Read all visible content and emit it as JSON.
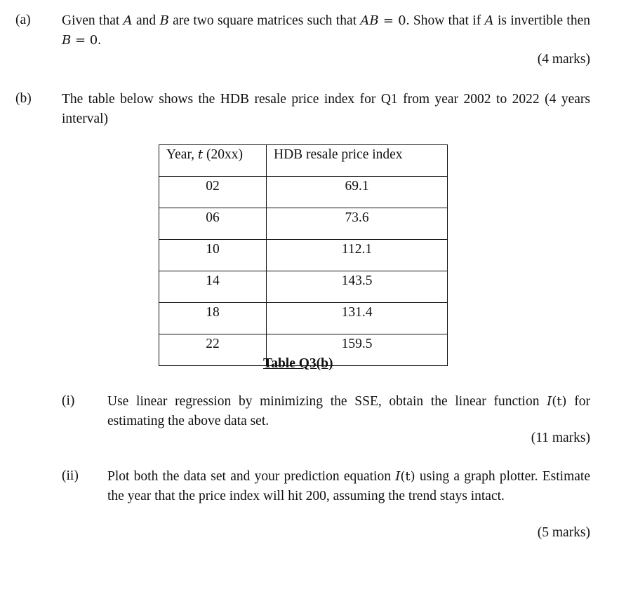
{
  "part_a": {
    "label": "(a)",
    "text_1": "Given that ",
    "var_A": "A",
    "text_2": " and ",
    "var_B": "B",
    "text_3": " are two square matrices such that ",
    "expr_AB": "AB",
    "eq_zero": " = 0",
    "text_4": ". Show that if ",
    "var_A2": "A",
    "text_5": " is invertible then ",
    "var_B2": "B",
    "eq_zero2": " = 0",
    "text_6": ".",
    "marks": "(4 marks)"
  },
  "part_b": {
    "label": "(b)",
    "intro": "The table below shows the HDB resale price index for Q1 from year 2002 to 2022 (4 years interval)",
    "table": {
      "header_year_prefix": "Year, ",
      "header_year_var": "t",
      "header_year_suffix": " (20xx)",
      "header_index": "HDB resale price index",
      "rows": [
        {
          "year": "02",
          "index": "69.1"
        },
        {
          "year": "06",
          "index": "73.6"
        },
        {
          "year": "10",
          "index": "112.1"
        },
        {
          "year": "14",
          "index": "143.5"
        },
        {
          "year": "18",
          "index": "131.4"
        },
        {
          "year": "22",
          "index": "159.5"
        }
      ],
      "caption": "Table Q3(b)"
    },
    "sub_i": {
      "label": "(i)",
      "text_1": "Use linear regression by minimizing the SSE, obtain the linear function ",
      "func": "I",
      "func_arg": "(t)",
      "text_2": " for estimating the above data set.",
      "marks": "(11 marks)"
    },
    "sub_ii": {
      "label": "(ii)",
      "text_1": "Plot both the data set and your prediction equation ",
      "func": "I",
      "func_arg": "(t)",
      "text_2": " using a graph plotter. Estimate the year that the price index will hit 200, assuming the trend stays intact.",
      "marks": "(5 marks)"
    }
  }
}
